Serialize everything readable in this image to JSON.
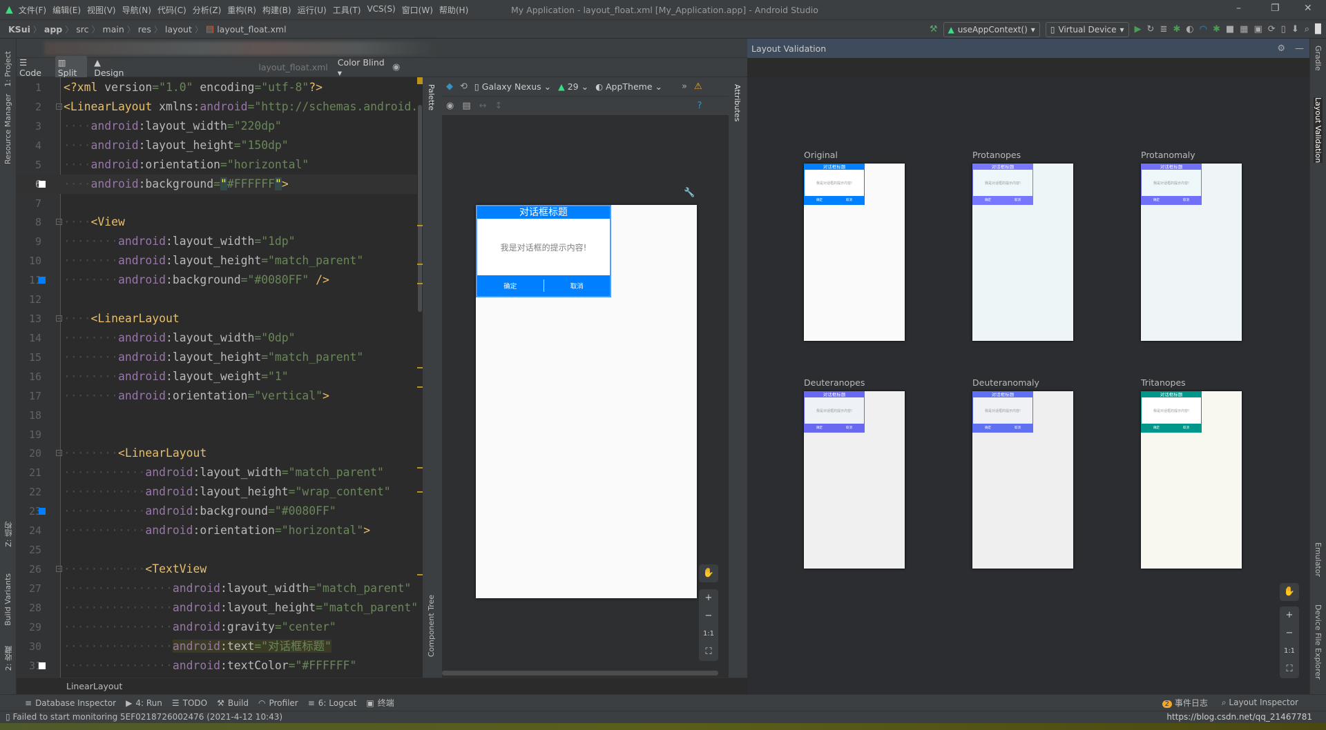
{
  "window": {
    "title": "My Application - layout_float.xml [My_Application.app] - Android Studio",
    "minimize": "–",
    "restore": "❐",
    "close": "✕"
  },
  "menu": [
    "文件(F)",
    "编辑(E)",
    "视图(V)",
    "导航(N)",
    "代码(C)",
    "分析(Z)",
    "重构(R)",
    "构建(B)",
    "运行(U)",
    "工具(T)",
    "VCS(S)",
    "窗口(W)",
    "帮助(H)"
  ],
  "breadcrumb": [
    "KSui",
    "app",
    "src",
    "main",
    "res",
    "layout",
    "layout_float.xml"
  ],
  "toolbar": {
    "run_config": "useAppContext()",
    "device": "Virtual Device"
  },
  "editor_modes": {
    "code": "Code",
    "split": "Split",
    "design": "Design",
    "selected": "split"
  },
  "left_strip": {
    "project": "1: Project",
    "resource_manager": "Resource Manager",
    "structure": "Z: 结构",
    "build_variants": "Build Variants",
    "favorites": "2: 收藏"
  },
  "right_strip": {
    "gradle": "Gradle",
    "layout_validation": "Layout Validation",
    "emulator": "Emulator",
    "device_file_explorer": "Device File Explorer"
  },
  "code_lines": [
    {
      "n": 1,
      "indent": 0,
      "tokens": [
        [
          "tag",
          "<?xml"
        ],
        [
          "pl",
          " "
        ],
        [
          "attr",
          "version"
        ],
        [
          "val",
          "=\"1.0\""
        ],
        [
          "pl",
          " "
        ],
        [
          "attr",
          "encoding"
        ],
        [
          "val",
          "=\"utf-8\""
        ],
        [
          "tag",
          "?>"
        ]
      ]
    },
    {
      "n": 2,
      "indent": 0,
      "fold": true,
      "tokens": [
        [
          "tag",
          "<LinearLayout"
        ],
        [
          "pl",
          " "
        ],
        [
          "attr",
          "xmlns:"
        ],
        [
          "ns",
          "android"
        ],
        [
          "val",
          "=\"http://schemas.android."
        ]
      ]
    },
    {
      "n": 3,
      "indent": 4,
      "tokens": [
        [
          "ns",
          "android"
        ],
        [
          "attr",
          ":layout_width"
        ],
        [
          "val",
          "=\"220dp\""
        ]
      ]
    },
    {
      "n": 4,
      "indent": 4,
      "tokens": [
        [
          "ns",
          "android"
        ],
        [
          "attr",
          ":layout_height"
        ],
        [
          "val",
          "=\"150dp\""
        ]
      ]
    },
    {
      "n": 5,
      "indent": 4,
      "tokens": [
        [
          "ns",
          "android"
        ],
        [
          "attr",
          ":orientation"
        ],
        [
          "val",
          "=\"horizontal\""
        ]
      ]
    },
    {
      "n": 6,
      "indent": 4,
      "current": true,
      "marker": "#FFFFFF",
      "tokens": [
        [
          "ns",
          "android"
        ],
        [
          "attr",
          ":background"
        ],
        [
          "val",
          "="
        ],
        [
          "q",
          "\""
        ],
        [
          "val",
          "#FFFFFF"
        ],
        [
          "q",
          "\""
        ],
        [
          "tag",
          ">"
        ]
      ]
    },
    {
      "n": 7,
      "indent": 0,
      "tokens": []
    },
    {
      "n": 8,
      "indent": 4,
      "fold": true,
      "tokens": [
        [
          "tag",
          "<View"
        ]
      ]
    },
    {
      "n": 9,
      "indent": 8,
      "tokens": [
        [
          "ns",
          "android"
        ],
        [
          "attr",
          ":layout_width"
        ],
        [
          "val",
          "=\"1dp\""
        ]
      ]
    },
    {
      "n": 10,
      "indent": 8,
      "tokens": [
        [
          "ns",
          "android"
        ],
        [
          "attr",
          ":layout_height"
        ],
        [
          "val",
          "=\"match_parent\""
        ]
      ]
    },
    {
      "n": 11,
      "indent": 8,
      "marker": "#0080FF",
      "tokens": [
        [
          "ns",
          "android"
        ],
        [
          "attr",
          ":background"
        ],
        [
          "val",
          "=\"#0080FF\""
        ],
        [
          "tag",
          " />"
        ]
      ]
    },
    {
      "n": 12,
      "indent": 0,
      "tokens": []
    },
    {
      "n": 13,
      "indent": 4,
      "fold": true,
      "tokens": [
        [
          "tag",
          "<LinearLayout"
        ]
      ]
    },
    {
      "n": 14,
      "indent": 8,
      "tokens": [
        [
          "ns",
          "android"
        ],
        [
          "attr",
          ":layout_width"
        ],
        [
          "val",
          "=\"0dp\""
        ]
      ]
    },
    {
      "n": 15,
      "indent": 8,
      "tokens": [
        [
          "ns",
          "android"
        ],
        [
          "attr",
          ":layout_height"
        ],
        [
          "val",
          "=\"match_parent\""
        ]
      ]
    },
    {
      "n": 16,
      "indent": 8,
      "tokens": [
        [
          "ns",
          "android"
        ],
        [
          "attr",
          ":layout_weight"
        ],
        [
          "val",
          "=\"1\""
        ]
      ]
    },
    {
      "n": 17,
      "indent": 8,
      "tokens": [
        [
          "ns",
          "android"
        ],
        [
          "attr",
          ":orientation"
        ],
        [
          "val",
          "=\"vertical\""
        ],
        [
          "tag",
          ">"
        ]
      ]
    },
    {
      "n": 18,
      "indent": 0,
      "tokens": []
    },
    {
      "n": 19,
      "indent": 0,
      "tokens": []
    },
    {
      "n": 20,
      "indent": 8,
      "fold": true,
      "tokens": [
        [
          "tag",
          "<LinearLayout"
        ]
      ]
    },
    {
      "n": 21,
      "indent": 12,
      "tokens": [
        [
          "ns",
          "android"
        ],
        [
          "attr",
          ":layout_width"
        ],
        [
          "val",
          "=\"match_parent\""
        ]
      ]
    },
    {
      "n": 22,
      "indent": 12,
      "tokens": [
        [
          "ns",
          "android"
        ],
        [
          "attr",
          ":layout_height"
        ],
        [
          "val",
          "=\"wrap_content\""
        ]
      ]
    },
    {
      "n": 23,
      "indent": 12,
      "marker": "#0080FF",
      "tokens": [
        [
          "ns",
          "android"
        ],
        [
          "attr",
          ":background"
        ],
        [
          "val",
          "=\"#0080FF\""
        ]
      ]
    },
    {
      "n": 24,
      "indent": 12,
      "tokens": [
        [
          "ns",
          "android"
        ],
        [
          "attr",
          ":orientation"
        ],
        [
          "val",
          "=\"horizontal\""
        ],
        [
          "tag",
          ">"
        ]
      ]
    },
    {
      "n": 25,
      "indent": 0,
      "tokens": []
    },
    {
      "n": 26,
      "indent": 12,
      "fold": true,
      "tokens": [
        [
          "tag",
          "<TextView"
        ]
      ]
    },
    {
      "n": 27,
      "indent": 16,
      "tokens": [
        [
          "ns",
          "android"
        ],
        [
          "attr",
          ":layout_width"
        ],
        [
          "val",
          "=\"match_parent\""
        ]
      ]
    },
    {
      "n": 28,
      "indent": 16,
      "tokens": [
        [
          "ns",
          "android"
        ],
        [
          "attr",
          ":layout_height"
        ],
        [
          "val",
          "=\"match_parent\""
        ]
      ]
    },
    {
      "n": 29,
      "indent": 16,
      "tokens": [
        [
          "ns",
          "android"
        ],
        [
          "attr",
          ":gravity"
        ],
        [
          "val",
          "=\"center\""
        ]
      ]
    },
    {
      "n": 30,
      "indent": 16,
      "highlight": true,
      "tokens": [
        [
          "ns",
          "android"
        ],
        [
          "attr",
          ":text"
        ],
        [
          "val",
          "=\"对话框标题\""
        ]
      ]
    },
    {
      "n": 31,
      "indent": 16,
      "marker": "#FFFFFF",
      "tokens": [
        [
          "ns",
          "android"
        ],
        [
          "attr",
          ":textColor"
        ],
        [
          "val",
          "=\"#FFFFFF\""
        ]
      ]
    }
  ],
  "editor_breadcrumb": "LinearLayout",
  "palette": {
    "palette": "Palette",
    "component_tree": "Component Tree",
    "attributes": "Attributes"
  },
  "design_toolbar": {
    "device": "Galaxy Nexus",
    "api": "29",
    "theme": "AppTheme"
  },
  "dialog": {
    "title": "对话框标题",
    "message": "我是对话框的提示内容!",
    "ok": "确定",
    "cancel": "取消",
    "accent": "#0080FF"
  },
  "zoom_controls": {
    "pan": "✋",
    "zoom_in": "+",
    "zoom_out": "−",
    "actual": "1:1",
    "fit": "⛶"
  },
  "layout_validation": {
    "title": "Layout Validation",
    "file": "layout_float.xml",
    "mode": "Color Blind",
    "cards": [
      {
        "label": "Original",
        "header": "#0080FF",
        "body": "#FFFFFF",
        "screen": "#FAFAFA"
      },
      {
        "label": "Protanopes",
        "header": "#7878FF",
        "body": "#EEF8FA",
        "screen": "#EEF5F6"
      },
      {
        "label": "Protanomaly",
        "header": "#7070F8",
        "body": "#EEF8FA",
        "screen": "#EFF5F6"
      },
      {
        "label": "Deuteranopes",
        "header": "#6868F0",
        "body": "#EEF1F6",
        "screen": "#F0F0F0"
      },
      {
        "label": "Deuteranomaly",
        "header": "#5F70F2",
        "body": "#F0F1F4",
        "screen": "#EFEFEF"
      },
      {
        "label": "Tritanopes",
        "header": "#00968A",
        "body": "#FFFFFF",
        "screen": "#F8F8F0"
      }
    ]
  },
  "tool_windows": [
    "Database Inspector",
    "4: Run",
    "TODO",
    "Build",
    "Profiler",
    "6: Logcat",
    "终端"
  ],
  "tool_windows_right": {
    "event_log_count": "2",
    "event_log": "事件日志",
    "layout_inspector": "Layout Inspector"
  },
  "status": {
    "message": "Failed to start monitoring 5EF0218726002476 (2021-4-12 10:43)",
    "watermark": "https://blog.csdn.net/qq_21467781"
  }
}
